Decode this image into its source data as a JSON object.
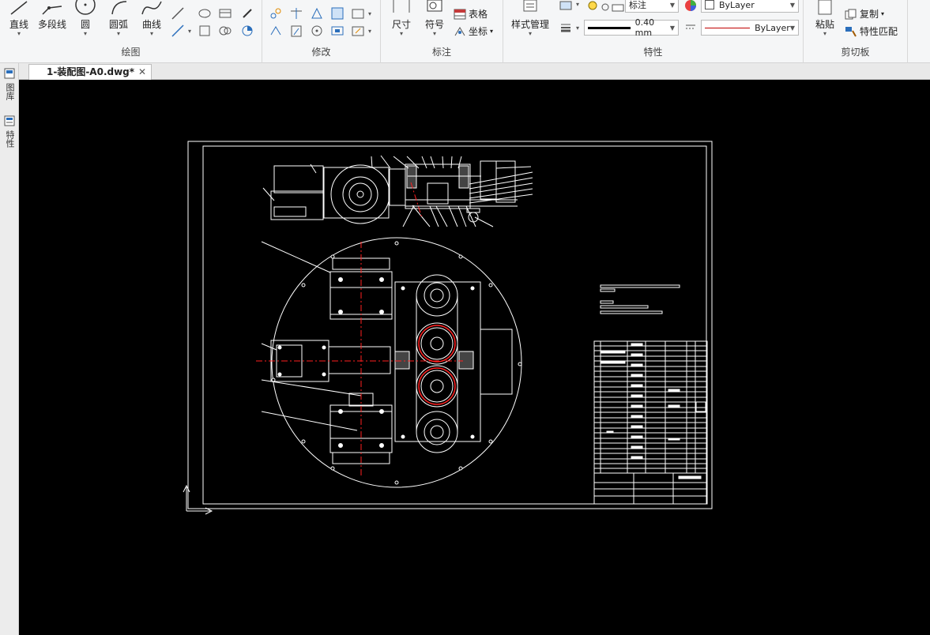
{
  "ribbon": {
    "draw": {
      "label": "绘图",
      "line": "直线",
      "polyline": "多段线",
      "circle": "圆",
      "arc": "圆弧",
      "curve": "曲线"
    },
    "modify": {
      "label": "修改"
    },
    "annotate": {
      "label": "标注",
      "dimension": "尺寸",
      "symbol": "符号",
      "table": "表格",
      "coordinate": "坐标"
    },
    "properties": {
      "label": "特性",
      "style_manager": "样式管理",
      "layer_value": "标注",
      "color_value": "ByLayer",
      "lineweight_value": "0.40 mm",
      "linetype_value": "ByLayer"
    },
    "clipboard": {
      "label": "剪切板",
      "paste": "粘贴",
      "copy": "复制",
      "match_properties": "特性匹配"
    }
  },
  "tabs": {
    "document": "1-装配图-A0.dwg*"
  },
  "side_palette": {
    "library": "图库",
    "properties": "特性"
  },
  "colors": {
    "canvas_bg": "#000000",
    "drawing_lines": "#ffffff",
    "center_lines": "#ff2020",
    "linetype_red": "#c00000"
  }
}
